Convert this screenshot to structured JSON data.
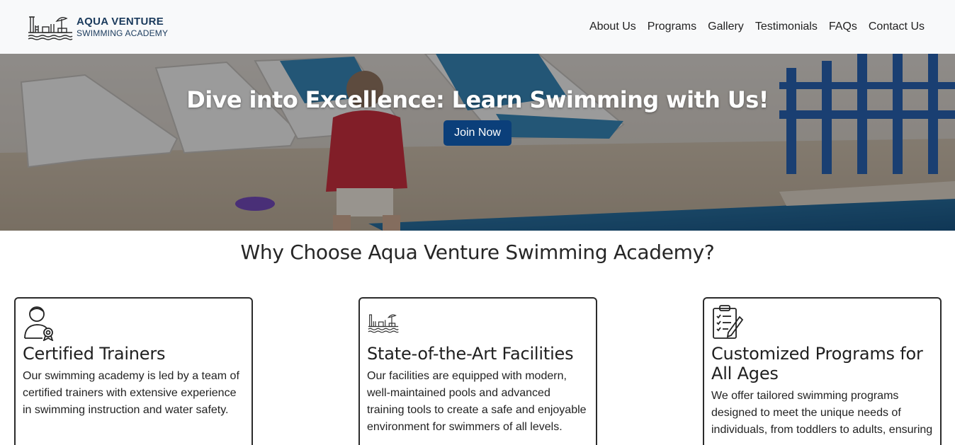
{
  "brand": {
    "name_line1": "AQUA VENTURE",
    "name_line2": "SWIMMING ACADEMY",
    "logo_icon": "pool-pier-umbrella-icon",
    "color": "#1a3a5c"
  },
  "nav": {
    "items": [
      {
        "label": "About Us"
      },
      {
        "label": "Programs"
      },
      {
        "label": "Gallery"
      },
      {
        "label": "Testimonials"
      },
      {
        "label": "FAQs"
      },
      {
        "label": "Contact Us"
      }
    ]
  },
  "hero": {
    "title": "Dive into Excellence: Learn Swimming with Us!",
    "cta_label": "Join Now",
    "cta_color": "#0b3f7a"
  },
  "features": {
    "heading": "Why Choose Aqua Venture Swimming Academy?",
    "cards": [
      {
        "icon": "certified-trainer-icon",
        "title": "Certified Trainers",
        "text": "Our swimming academy is led by a team of certified trainers with extensive experience in swimming instruction and water safety."
      },
      {
        "icon": "pool-facility-icon",
        "title": "State-of-the-Art Facilities",
        "text": "Our facilities are equipped with modern, well-maintained pools and advanced training tools to create a safe and enjoyable environment for swimmers of all levels."
      },
      {
        "icon": "checklist-icon",
        "title": "Customized Programs for All Ages",
        "text": "We offer tailored swimming programs designed to meet the unique needs of individuals, from toddlers to adults, ensuring"
      }
    ]
  }
}
